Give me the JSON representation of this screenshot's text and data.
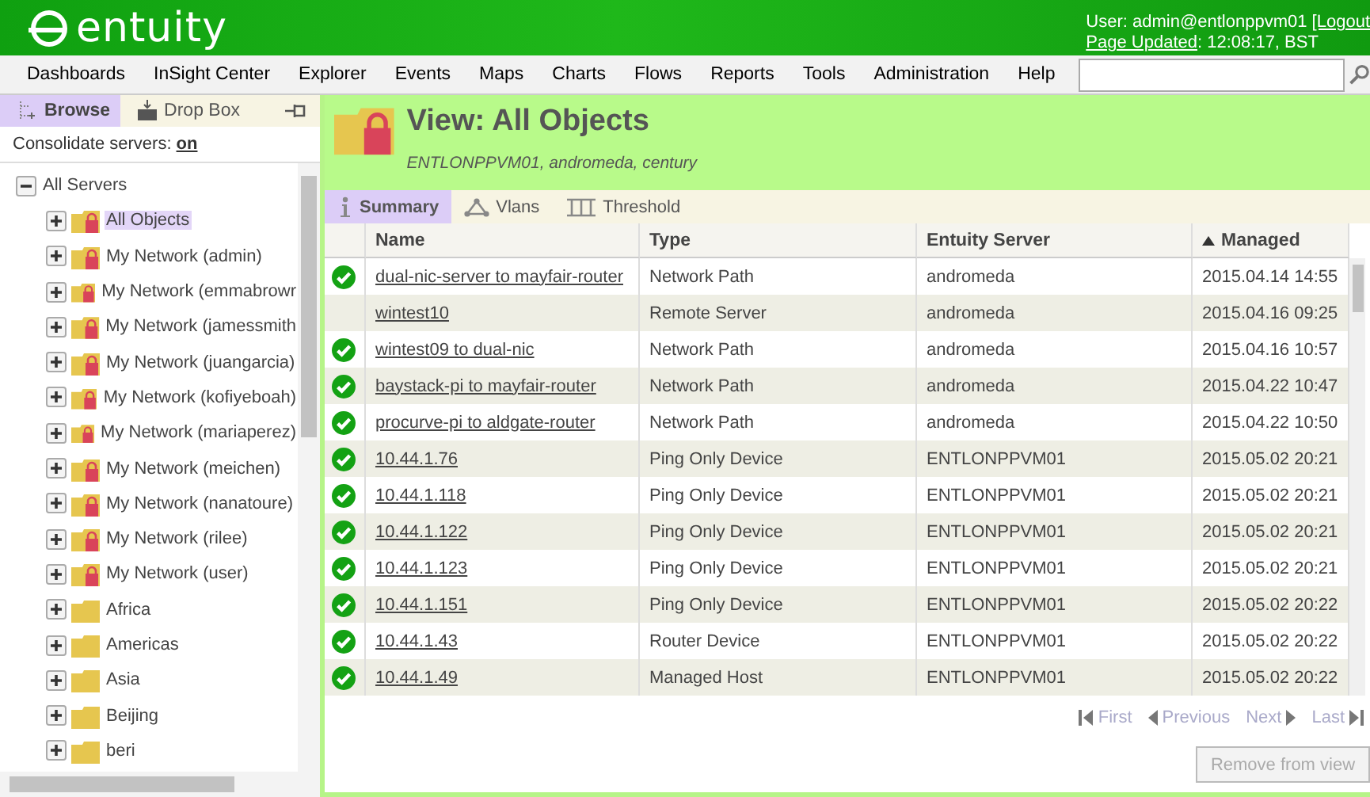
{
  "header": {
    "logo": "entuity",
    "user": "User: admin@entlonppvm01",
    "logout": "[Logout",
    "page_updated_label": "Page Updated",
    "page_updated_value": ": 12:08:17, BST"
  },
  "menu": [
    "Dashboards",
    "InSight Center",
    "Explorer",
    "Events",
    "Maps",
    "Charts",
    "Flows",
    "Reports",
    "Tools",
    "Administration",
    "Help"
  ],
  "sidebar": {
    "tabs": [
      {
        "label": "Browse",
        "selected": true
      },
      {
        "label": "Drop Box",
        "selected": false
      }
    ],
    "consolidate_label": "Consolidate servers:",
    "consolidate_value": "on",
    "tree": {
      "label": "All Servers",
      "expanded": true,
      "children": [
        {
          "label": "All Objects",
          "locked": true,
          "selected": true,
          "expanded": false
        },
        {
          "label": "My Network (admin)",
          "locked": true,
          "selected": false,
          "expanded": false
        },
        {
          "label": "My Network (emmabrowr",
          "locked": true,
          "selected": false,
          "expanded": false
        },
        {
          "label": "My Network (jamessmith",
          "locked": true,
          "selected": false,
          "expanded": false
        },
        {
          "label": "My Network (juangarcia)",
          "locked": true,
          "selected": false,
          "expanded": false
        },
        {
          "label": "My Network (kofiyeboah)",
          "locked": true,
          "selected": false,
          "expanded": false
        },
        {
          "label": "My Network (mariaperez)",
          "locked": true,
          "selected": false,
          "expanded": false
        },
        {
          "label": "My Network (meichen)",
          "locked": true,
          "selected": false,
          "expanded": false
        },
        {
          "label": "My Network (nanatoure)",
          "locked": true,
          "selected": false,
          "expanded": false
        },
        {
          "label": "My Network (rilee)",
          "locked": true,
          "selected": false,
          "expanded": false
        },
        {
          "label": "My Network (user)",
          "locked": true,
          "selected": false,
          "expanded": false
        },
        {
          "label": "Africa",
          "locked": false,
          "selected": false,
          "expanded": false
        },
        {
          "label": "Americas",
          "locked": false,
          "selected": false,
          "expanded": false
        },
        {
          "label": "Asia",
          "locked": false,
          "selected": false,
          "expanded": false
        },
        {
          "label": "Beijing",
          "locked": false,
          "selected": false,
          "expanded": false
        },
        {
          "label": "beri",
          "locked": false,
          "selected": false,
          "expanded": false
        }
      ]
    }
  },
  "view": {
    "title": "View: All Objects",
    "subtitle": "ENTLONPPVM01, andromeda, century",
    "tabs": [
      {
        "label": "Summary",
        "selected": true
      },
      {
        "label": "Vlans",
        "selected": false
      },
      {
        "label": "Threshold",
        "selected": false
      }
    ],
    "table": {
      "columns": [
        {
          "label": "Name",
          "sorted": false
        },
        {
          "label": "Type",
          "sorted": false
        },
        {
          "label": "Entuity Server",
          "sorted": false
        },
        {
          "label": "Managed",
          "sorted": true
        }
      ],
      "rows": [
        {
          "up": true,
          "name": "dual-nic-server to mayfair-router",
          "type": "Network Path",
          "server": "andromeda",
          "managed": "2015.04.14 14:55"
        },
        {
          "up": false,
          "name": "wintest10",
          "type": "Remote Server",
          "server": "andromeda",
          "managed": "2015.04.16 09:25"
        },
        {
          "up": true,
          "name": "wintest09 to dual-nic",
          "type": "Network Path",
          "server": "andromeda",
          "managed": "2015.04.16 10:57"
        },
        {
          "up": true,
          "name": "baystack-pi to mayfair-router",
          "type": "Network Path",
          "server": "andromeda",
          "managed": "2015.04.22 10:47"
        },
        {
          "up": true,
          "name": "procurve-pi to aldgate-router",
          "type": "Network Path",
          "server": "andromeda",
          "managed": "2015.04.22 10:50"
        },
        {
          "up": true,
          "name": "10.44.1.76",
          "type": "Ping Only Device",
          "server": "ENTLONPPVM01",
          "managed": "2015.05.02 20:21"
        },
        {
          "up": true,
          "name": "10.44.1.118",
          "type": "Ping Only Device",
          "server": "ENTLONPPVM01",
          "managed": "2015.05.02 20:21"
        },
        {
          "up": true,
          "name": "10.44.1.122",
          "type": "Ping Only Device",
          "server": "ENTLONPPVM01",
          "managed": "2015.05.02 20:21"
        },
        {
          "up": true,
          "name": "10.44.1.123",
          "type": "Ping Only Device",
          "server": "ENTLONPPVM01",
          "managed": "2015.05.02 20:21"
        },
        {
          "up": true,
          "name": "10.44.1.151",
          "type": "Ping Only Device",
          "server": "ENTLONPPVM01",
          "managed": "2015.05.02 20:22"
        },
        {
          "up": true,
          "name": "10.44.1.43",
          "type": "Router Device",
          "server": "ENTLONPPVM01",
          "managed": "2015.05.02 20:22"
        },
        {
          "up": true,
          "name": "10.44.1.49",
          "type": "Managed Host",
          "server": "ENTLONPPVM01",
          "managed": "2015.05.02 20:22"
        }
      ]
    },
    "pager": [
      {
        "label": "First",
        "kind": "first",
        "disabled": true
      },
      {
        "label": "Previous",
        "kind": "prev",
        "disabled": true
      },
      {
        "label": "Next",
        "kind": "next",
        "disabled": true
      },
      {
        "label": "Last",
        "kind": "last",
        "disabled": true
      }
    ],
    "remove_button": {
      "label": "Remove from view",
      "disabled": true
    }
  }
}
